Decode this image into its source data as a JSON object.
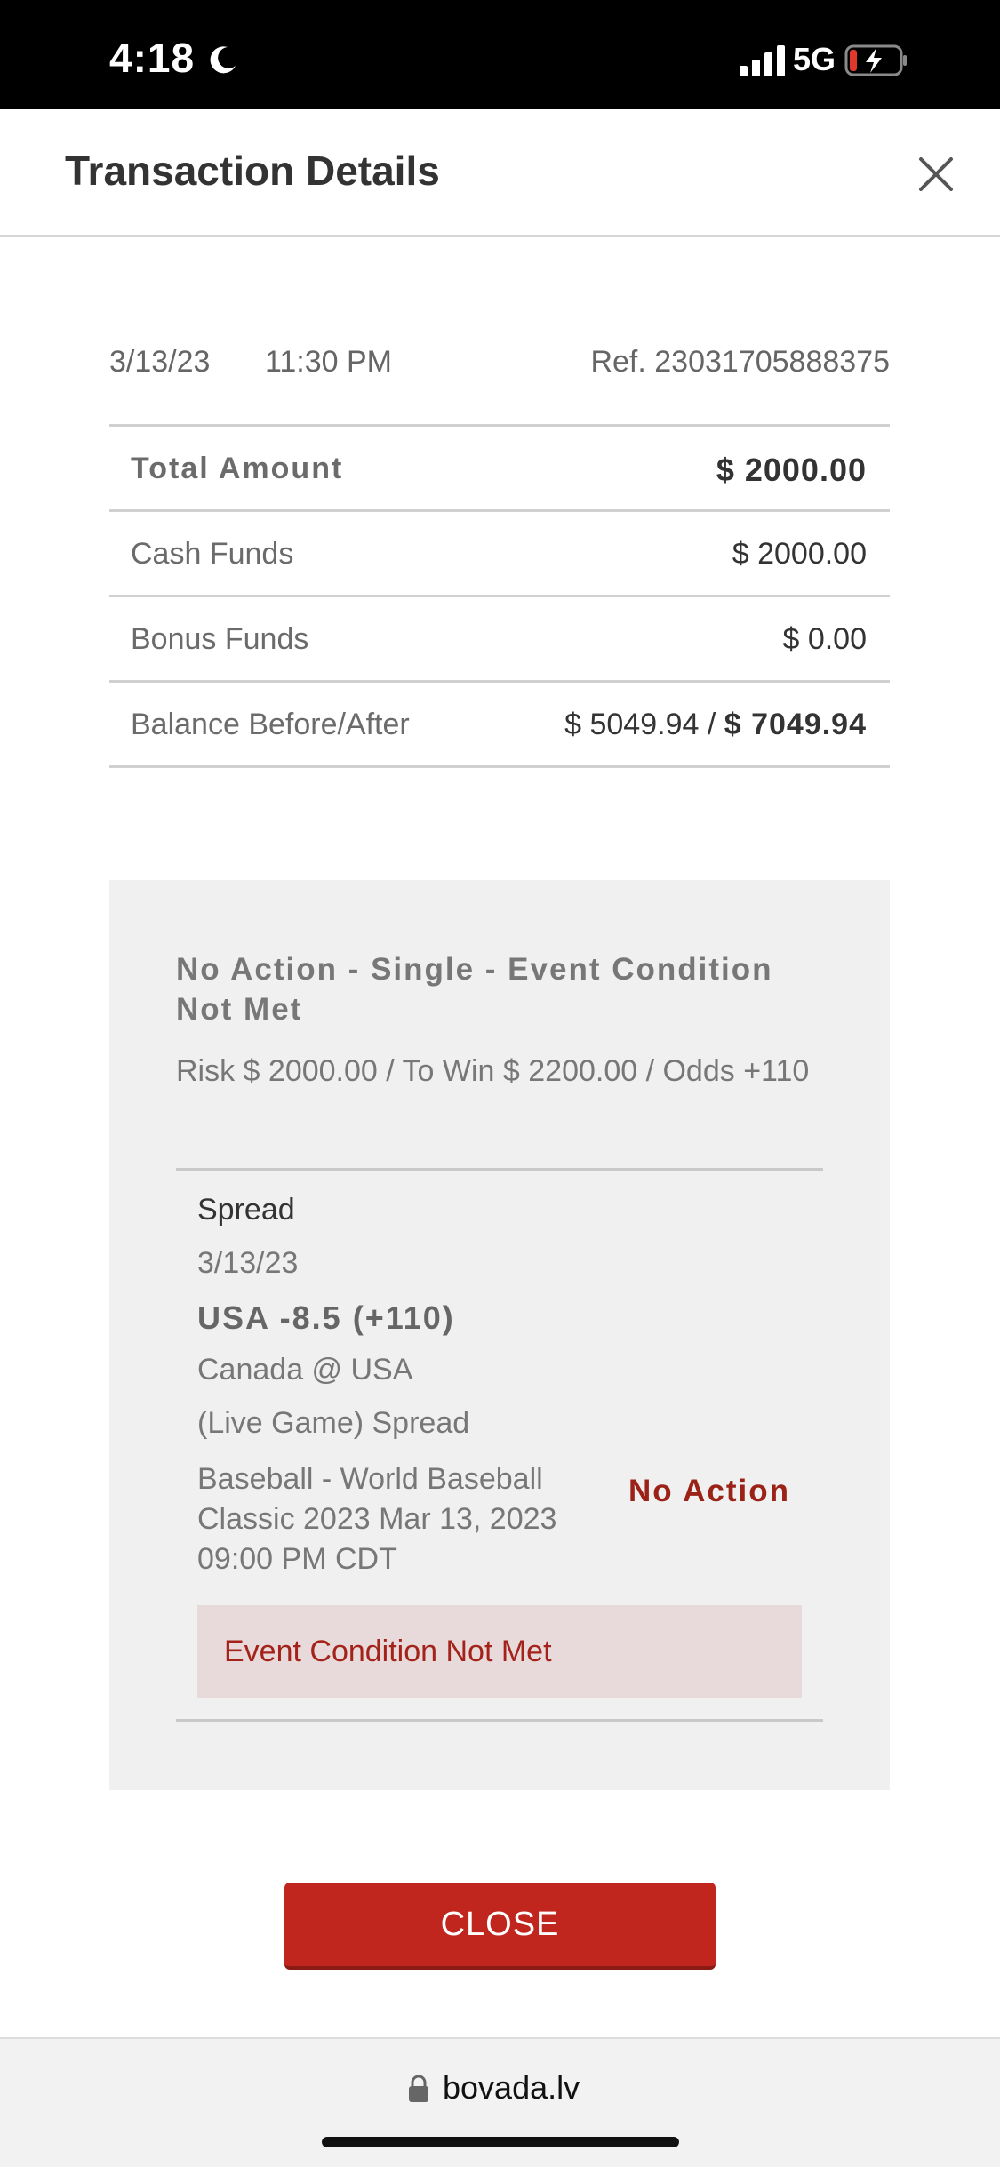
{
  "status_bar": {
    "time": "4:18",
    "network": "5G",
    "icons": [
      "moon-icon",
      "signal-icon",
      "battery-charging-icon"
    ]
  },
  "header": {
    "title": "Transaction Details",
    "close_icon": "close-icon"
  },
  "transaction": {
    "date": "3/13/23",
    "time": "11:30 PM",
    "ref": "Ref. 23031705888375"
  },
  "summary": {
    "total_label": "Total Amount",
    "total_value": "$ 2000.00",
    "cash_label": "Cash Funds",
    "cash_value": "$ 2000.00",
    "bonus_label": "Bonus Funds",
    "bonus_value": "$ 0.00",
    "balance_label": "Balance Before/After",
    "balance_before": "$ 5049.94 /",
    "balance_after": "$ 7049.94"
  },
  "bet": {
    "title": "No Action - Single - Event Condition Not Met",
    "risk_line": "Risk $ 2000.00 / To Win $ 2200.00 / Odds +110",
    "leg": {
      "market": "Spread",
      "date": "3/13/23",
      "selection": "USA -8.5 (+110)",
      "matchup": "Canada @ USA",
      "type": "(Live Game) Spread",
      "event": "Baseball - World Baseball Classic 2023 Mar 13, 2023 09:00 PM CDT",
      "status": "No Action"
    },
    "notice": "Event Condition Not Met"
  },
  "actions": {
    "close_label": "CLOSE"
  },
  "browser": {
    "url": "bovada.lv"
  },
  "colors": {
    "accent_red": "#c0261d",
    "status_red": "#9b2217",
    "notice_bg": "#e8dada",
    "card_bg": "#f0f0f0"
  }
}
